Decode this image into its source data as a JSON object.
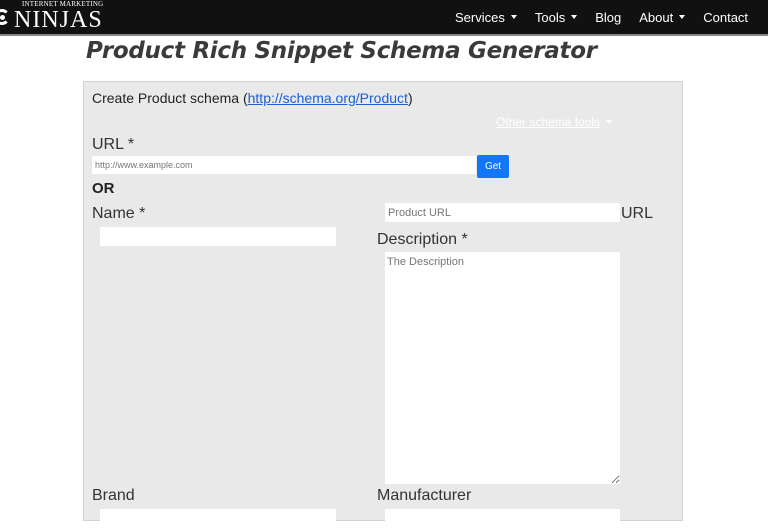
{
  "navbar": {
    "logo_small": "INTERNET MARKETING",
    "logo_big": "NINJAS",
    "items": [
      {
        "label": "Services",
        "has_dropdown": true
      },
      {
        "label": "Tools",
        "has_dropdown": true
      },
      {
        "label": "Blog",
        "has_dropdown": false
      },
      {
        "label": "About",
        "has_dropdown": true
      },
      {
        "label": "Contact",
        "has_dropdown": false
      }
    ]
  },
  "page": {
    "title": "Product Rich Snippet Schema Generator"
  },
  "panel": {
    "heading_prefix": "Create Product schema (",
    "heading_link": "http://schema.org/Product",
    "heading_suffix": ")",
    "other_tools_label": "Other schema tools",
    "url_label": "URL *",
    "url_placeholder": "http://www.example.com",
    "get_button": "Get",
    "or_label": "OR",
    "name_label": "Name *",
    "name_value": "",
    "product_url_placeholder": "Product URL",
    "product_url_side_label": "URL",
    "description_label": "Description *",
    "description_placeholder": "The Description",
    "brand_label": "Brand",
    "manufacturer_label": "Manufacturer"
  },
  "colors": {
    "navbar_bg": "#111111",
    "panel_bg": "#e9e9e9",
    "accent_button": "#1376f8",
    "link": "#1a5fd6"
  }
}
